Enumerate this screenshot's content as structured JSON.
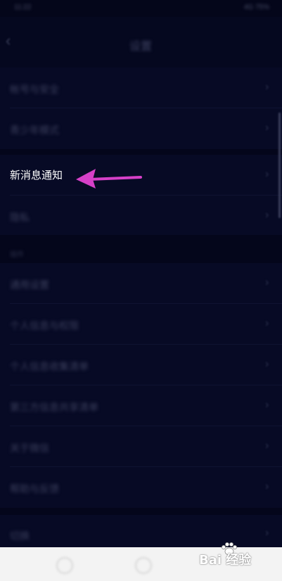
{
  "status_bar": {
    "time": "11:22",
    "right_info": "4G 75%"
  },
  "header": {
    "back_icon": "chevron-left-icon",
    "title": "设置"
  },
  "rows": [
    {
      "id": "account-security",
      "label": "帐号与安全"
    },
    {
      "id": "youth-mode",
      "label": "青少年模式"
    },
    {
      "id": "new-message-notify",
      "label": "新消息通知",
      "highlighted": true
    },
    {
      "id": "privacy",
      "label": "隐私"
    },
    {
      "id": "general",
      "label": "通用设置"
    },
    {
      "id": "wechat-auth",
      "label": "个人信息与权限"
    },
    {
      "id": "storage",
      "label": "个人信息收集清单"
    },
    {
      "id": "third-party",
      "label": "第三方信息共享清单"
    },
    {
      "id": "about",
      "label": "关于微信"
    },
    {
      "id": "help",
      "label": "帮助与反馈"
    },
    {
      "id": "switch-account",
      "label": "切换"
    }
  ],
  "section_header": "插件",
  "annotation": {
    "arrow_color": "#d640c8",
    "points_to": "新消息通知"
  },
  "watermark": {
    "text": "Bai 经验"
  },
  "colors": {
    "background": "#070a25",
    "highlight_text": "#ffffff",
    "navbar": "#f3f3f3"
  }
}
